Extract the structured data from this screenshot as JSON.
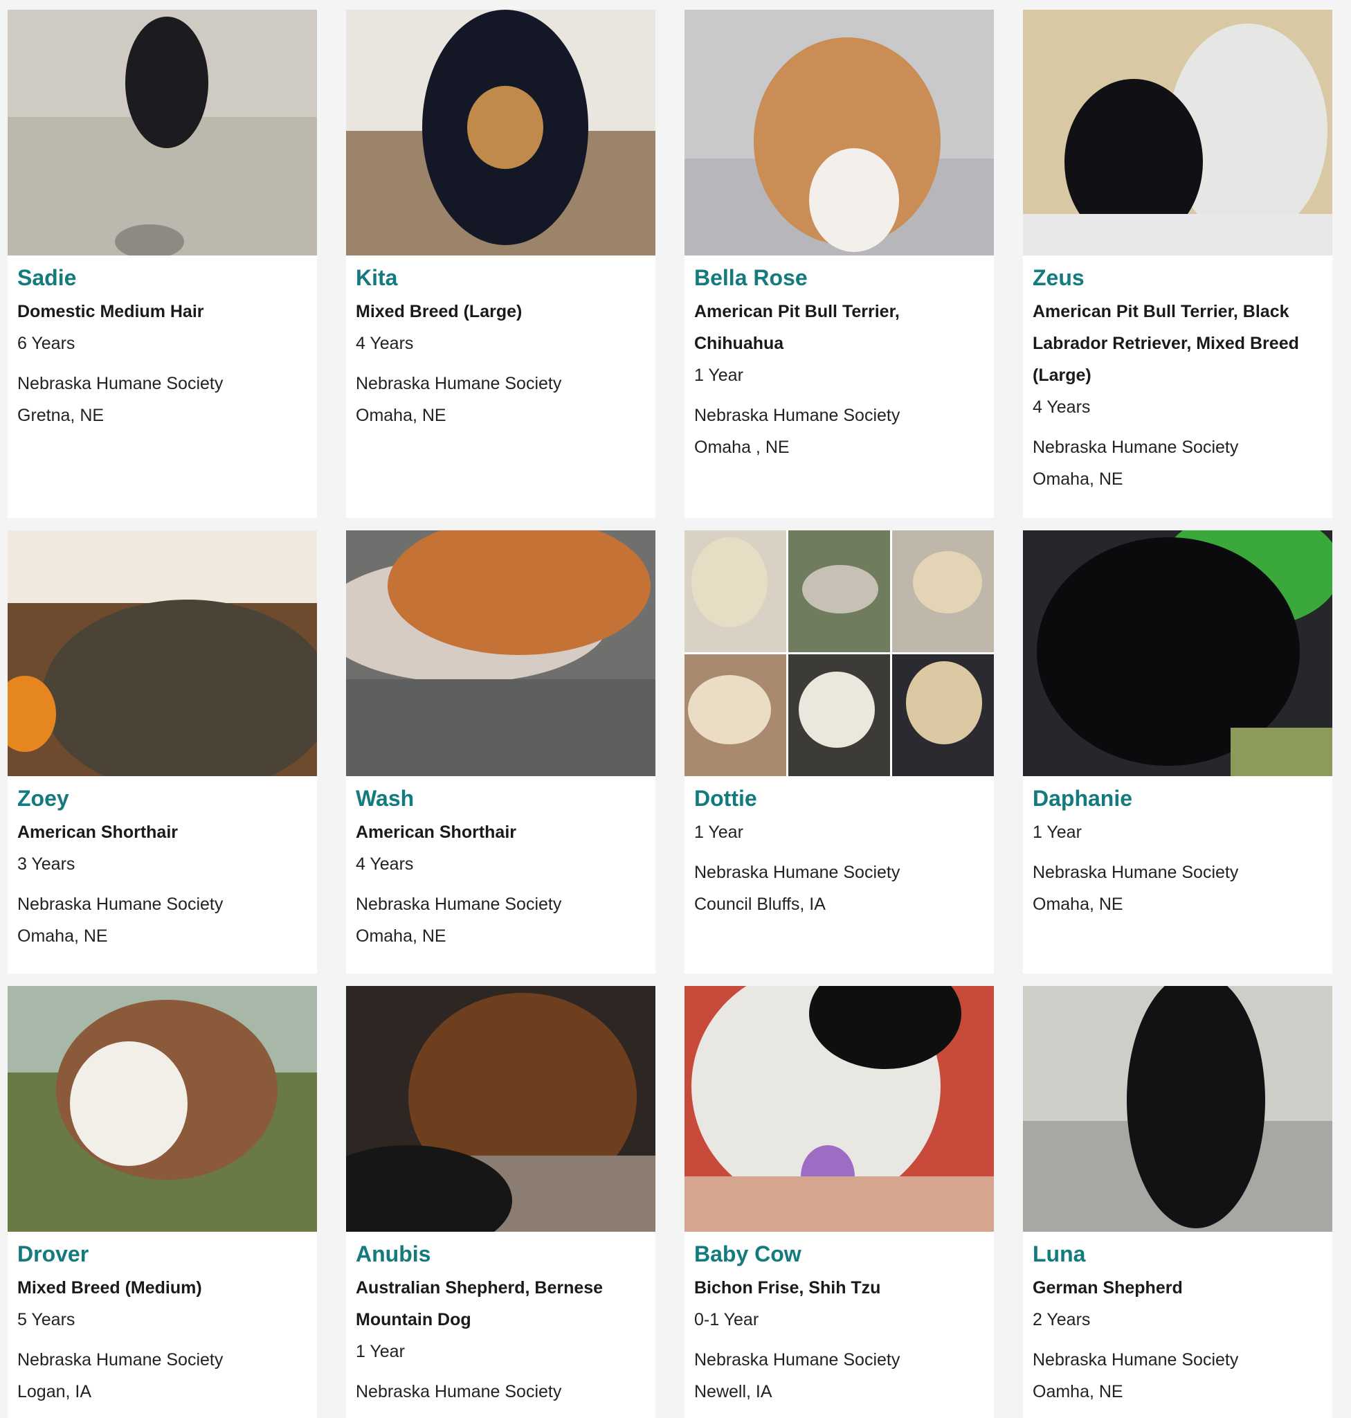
{
  "pets": [
    {
      "name": "Sadie",
      "breed": "Domestic Medium Hair",
      "age": "6 Years",
      "org": "Nebraska Humane Society",
      "location": "Gretna, NE",
      "photo_bg": "#cfcbc2",
      "photo_fg": "#1c1b1f",
      "photo_floor": "#bdb8ad"
    },
    {
      "name": "Kita",
      "breed": "Mixed Breed (Large)",
      "age": "4 Years",
      "org": "Nebraska Humane Society",
      "location": "Omaha, NE",
      "photo_bg": "#e9e6e0",
      "photo_fg": "#141826",
      "photo_floor": "#9b8469"
    },
    {
      "name": "Bella Rose",
      "breed": "American Pit Bull Terrier, Chihuahua",
      "age": "1 Year",
      "org": "Nebraska Humane Society",
      "location": "Omaha , NE",
      "photo_bg": "#c9c9cb",
      "photo_fg": "#c98d55",
      "photo_floor": "#b7b6ba"
    },
    {
      "name": "Zeus",
      "breed": "American Pit Bull Terrier, Black Labrador Retriever, Mixed Breed (Large)",
      "age": "4 Years",
      "org": "Nebraska Humane Society",
      "location": "Omaha, NE",
      "photo_bg": "#d8c9a4",
      "photo_fg": "#111115",
      "photo_floor": "#e6e6e4"
    },
    {
      "name": "Zoey",
      "breed": "American Shorthair",
      "age": "3 Years",
      "org": "Nebraska Humane Society",
      "location": "Omaha, NE",
      "photo_bg": "#efe9df",
      "photo_fg": "#4b4335",
      "photo_floor": "#6e4a2f"
    },
    {
      "name": "Wash",
      "breed": "American Shorthair",
      "age": "4 Years",
      "org": "Nebraska Humane Society",
      "location": "Omaha, NE",
      "photo_bg": "#6f6f6d",
      "photo_fg": "#c47236",
      "photo_floor": "#d7ccc4"
    },
    {
      "name": "Dottie",
      "breed": "",
      "age": "1 Year",
      "org": "Nebraska Humane Society",
      "location": "Council Bluffs, IA",
      "photo_bg": "#bfae93",
      "photo_fg": "#e0d2b8",
      "photo_floor": "#8b9a7a"
    },
    {
      "name": "Daphanie",
      "breed": "",
      "age": "1 Year",
      "org": "Nebraska Humane Society",
      "location": "Omaha, NE",
      "photo_bg": "#26272a",
      "photo_fg": "#0b0b0d",
      "photo_floor": "#8c9a5c"
    },
    {
      "name": "Drover",
      "breed": "Mixed Breed (Medium)",
      "age": "5 Years",
      "org": "Nebraska Humane Society",
      "location": "Logan, IA",
      "photo_bg": "#a7b7a8",
      "photo_fg": "#8a5a3a",
      "photo_floor": "#6a7a45"
    },
    {
      "name": "Anubis",
      "breed": "Australian Shepherd, Bernese Mountain Dog",
      "age": "1 Year",
      "org": "Nebraska Humane Society",
      "location": "",
      "photo_bg": "#2d2622",
      "photo_fg": "#6e3f1f",
      "photo_floor": "#8c7d72"
    },
    {
      "name": "Baby Cow",
      "breed": "Bichon Frise, Shih Tzu",
      "age": "0-1 Year",
      "org": "Nebraska Humane Society",
      "location": "Newell, IA",
      "photo_bg": "#c74a3a",
      "photo_fg": "#e9e7e2",
      "photo_floor": "#d6a58f"
    },
    {
      "name": "Luna",
      "breed": "German Shepherd",
      "age": "2 Years",
      "org": "Nebraska Humane Society",
      "location": "Oamha, NE",
      "photo_bg": "#cfcdc8",
      "photo_fg": "#121214",
      "photo_floor": "#a9a7a3"
    }
  ]
}
